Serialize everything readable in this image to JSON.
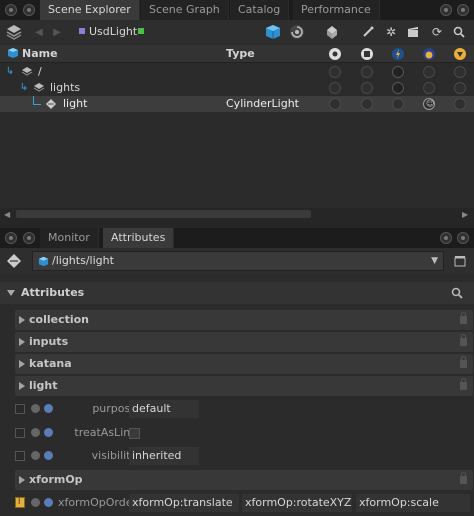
{
  "top_tabs": [
    "Scene Explorer",
    "Scene Graph",
    "Catalog",
    "Performance"
  ],
  "scene_explorer": {
    "stage_name": "UsdLight",
    "columns": {
      "name": "Name",
      "type": "Type"
    },
    "rows": [
      {
        "name": "/",
        "type": ""
      },
      {
        "name": "lights",
        "type": ""
      },
      {
        "name": "light",
        "type": "CylinderLight"
      }
    ]
  },
  "bottom_tabs": [
    "Monitor",
    "Attributes"
  ],
  "attributes": {
    "path": "/lights/light",
    "section_title": "Attributes",
    "groups": [
      "collection",
      "inputs",
      "katana",
      "light"
    ],
    "light_props": [
      {
        "label": "purpose",
        "value": "default"
      },
      {
        "label": "treatAsLine",
        "value": ""
      },
      {
        "label": "visibility",
        "value": "inherited"
      }
    ],
    "xformop_group": "xformOp",
    "xformop_order": {
      "label": "xformOpOrder",
      "values": [
        "xformOp:translate",
        "xformOp:rotateXYZ",
        "xformOp:scale"
      ]
    }
  },
  "colors": {
    "selection": "#3d3d3d",
    "accent_blue": "#3aa0d8",
    "accent_yellow": "#e8b03a"
  }
}
